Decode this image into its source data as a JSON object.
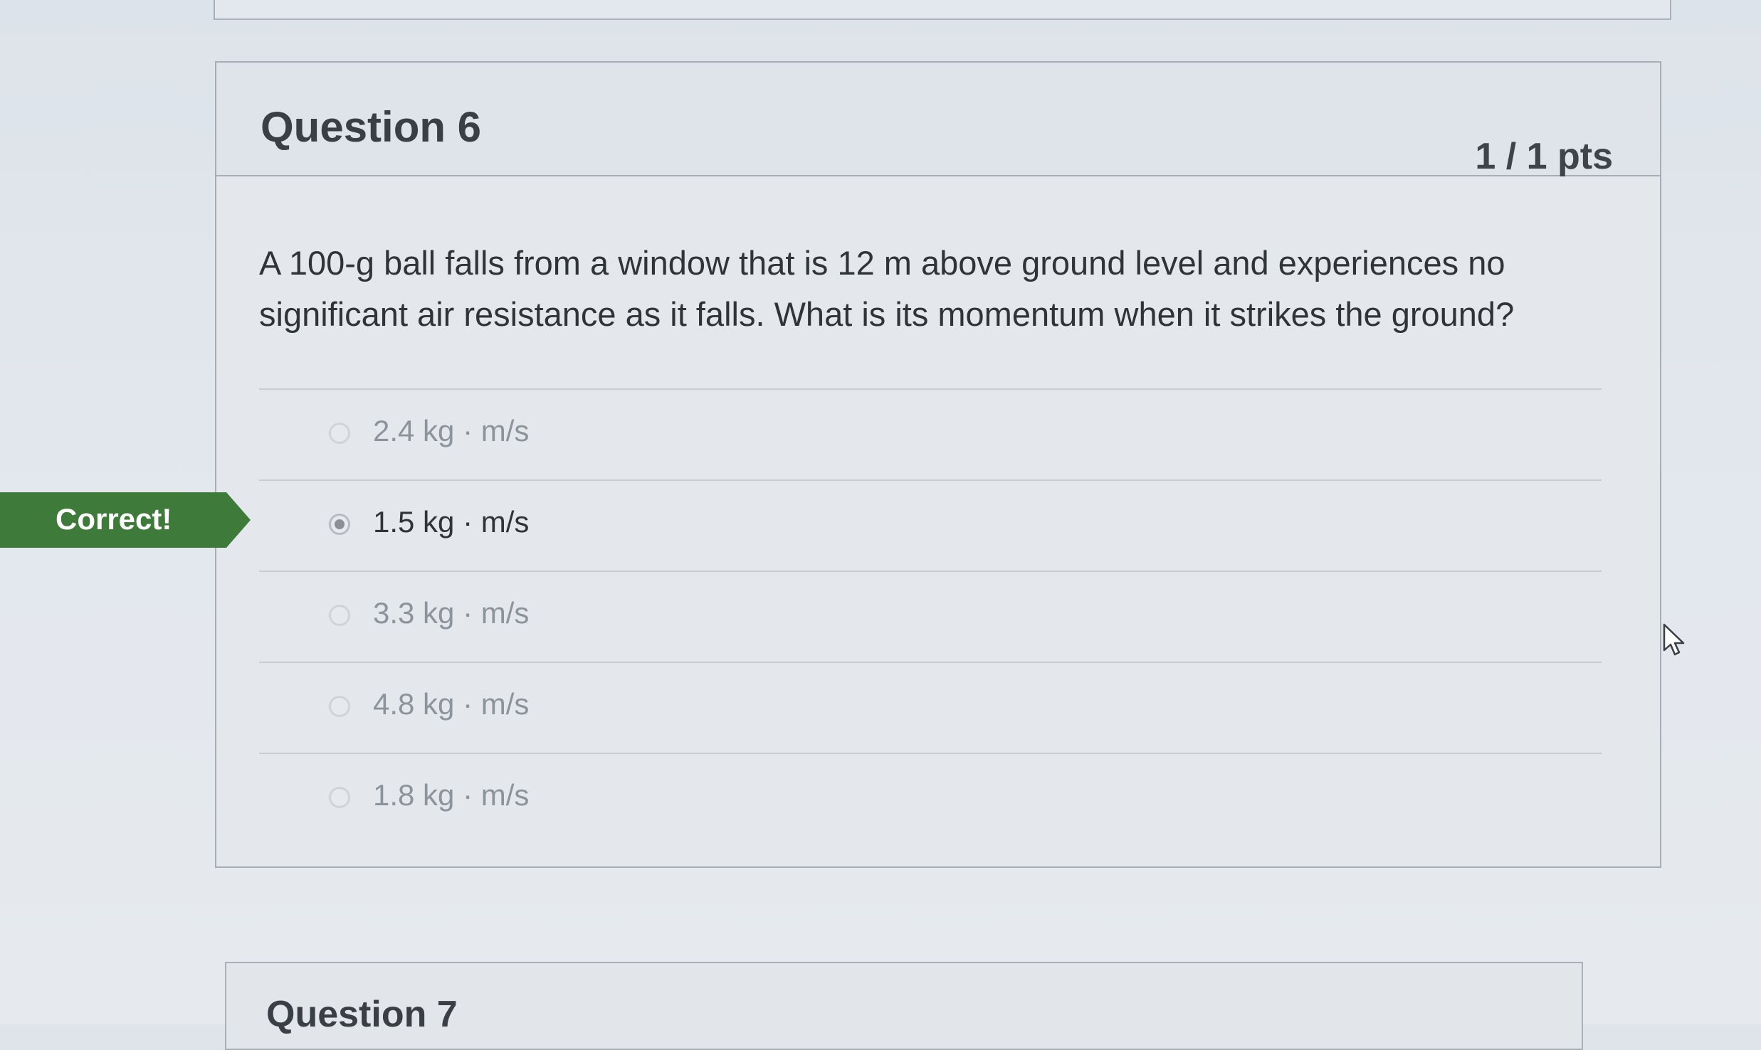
{
  "question": {
    "title": "Question 6",
    "points": "1 / 1 pts",
    "text": "A 100-g ball falls from a window that is 12 m above ground level and experiences no significant air resistance as it falls. What is its momentum when it strikes the ground?",
    "answers": [
      {
        "label": "2.4 kg · m/s",
        "selected": false
      },
      {
        "label": "1.5 kg · m/s",
        "selected": true
      },
      {
        "label": "3.3 kg · m/s",
        "selected": false
      },
      {
        "label": "4.8 kg · m/s",
        "selected": false
      },
      {
        "label": "1.8 kg · m/s",
        "selected": false
      }
    ]
  },
  "result_banner": {
    "label": "Correct!",
    "color": "#3e7a3a"
  },
  "next_question": {
    "title": "Question 7"
  },
  "icons": {
    "cursor": "mouse-pointer-icon",
    "radio": "radio-button-icon"
  }
}
